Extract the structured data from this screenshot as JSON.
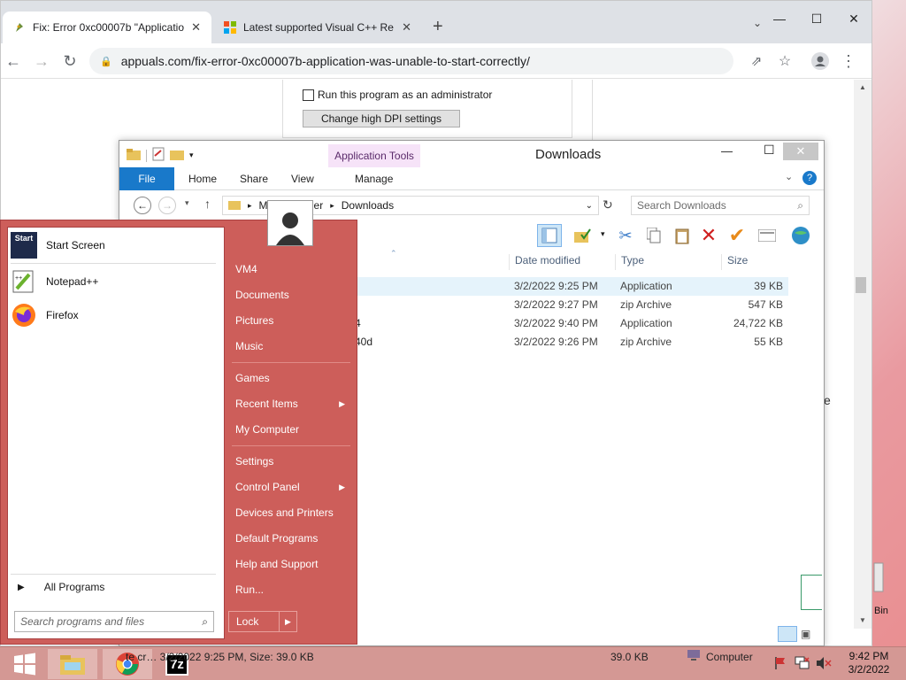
{
  "chrome": {
    "tabs": [
      {
        "title": "Fix: Error 0xc00007b \"Application",
        "close": "✕"
      },
      {
        "title": "Latest supported Visual C++ Re",
        "close": "✕"
      }
    ],
    "new_tab": "+",
    "url": "appuals.com/fix-error-0xc00007b-application-was-unable-to-start-correctly/"
  },
  "webpage": {
    "run_as_admin_label": "Run this program as an administrator",
    "dpi_button_label": "Change high DPI settings",
    "right_edge_text": "e",
    "recycle_label": "Bin"
  },
  "explorer": {
    "title": "Downloads",
    "app_tools": "Application Tools",
    "ribbon_tabs": [
      "File",
      "Home",
      "Share",
      "View",
      "Manage"
    ],
    "address": {
      "part1": "M",
      "part2": "er",
      "current": "Downloads"
    },
    "search_placeholder": "Search Downloads",
    "columns": {
      "date": "Date modified",
      "type": "Type",
      "size": "Size"
    },
    "files": [
      {
        "name": "",
        "date": "3/2/2022 9:25 PM",
        "type": "Application",
        "size": "39 KB",
        "selected": true
      },
      {
        "name": "",
        "date": "3/2/2022 9:27 PM",
        "type": "zip Archive",
        "size": "547 KB"
      },
      {
        "name": "4",
        "date": "3/2/2022 9:40 PM",
        "type": "Application",
        "size": "24,722 KB"
      },
      {
        "name": "40d",
        "date": "3/2/2022 9:26 PM",
        "type": "zip Archive",
        "size": "55 KB"
      }
    ]
  },
  "start_menu": {
    "left_items": [
      {
        "label": "Start Screen",
        "icon": "start-screen-icon"
      },
      {
        "label": "Notepad++",
        "icon": "notepadpp-icon"
      },
      {
        "label": "Firefox",
        "icon": "firefox-icon"
      }
    ],
    "start_icon_text": "Start",
    "all_programs": "All Programs",
    "search_placeholder": "Search programs and files",
    "right_items": [
      "VM4",
      "Documents",
      "Pictures",
      "Music",
      "Games",
      "Recent Items",
      "My Computer",
      "Settings",
      "Control Panel",
      "Devices and Printers",
      "Default Programs",
      "Help and Support",
      "Run..."
    ],
    "lock_label": "Lock"
  },
  "taskbar": {
    "status_text": "te cr… 3/2/2022 9:25 PM, Size: 39.0 KB",
    "size_text": "39.0 KB",
    "computer_label": "Computer",
    "time": "9:42 PM",
    "date": "3/2/2022",
    "seven_zip": "7z"
  },
  "colors": {
    "start_bg": "#cd5e5a",
    "taskbar_bg": "#d49894",
    "file_tab_bg": "#1979ca",
    "app_tools_bg": "#f6e3f8"
  }
}
